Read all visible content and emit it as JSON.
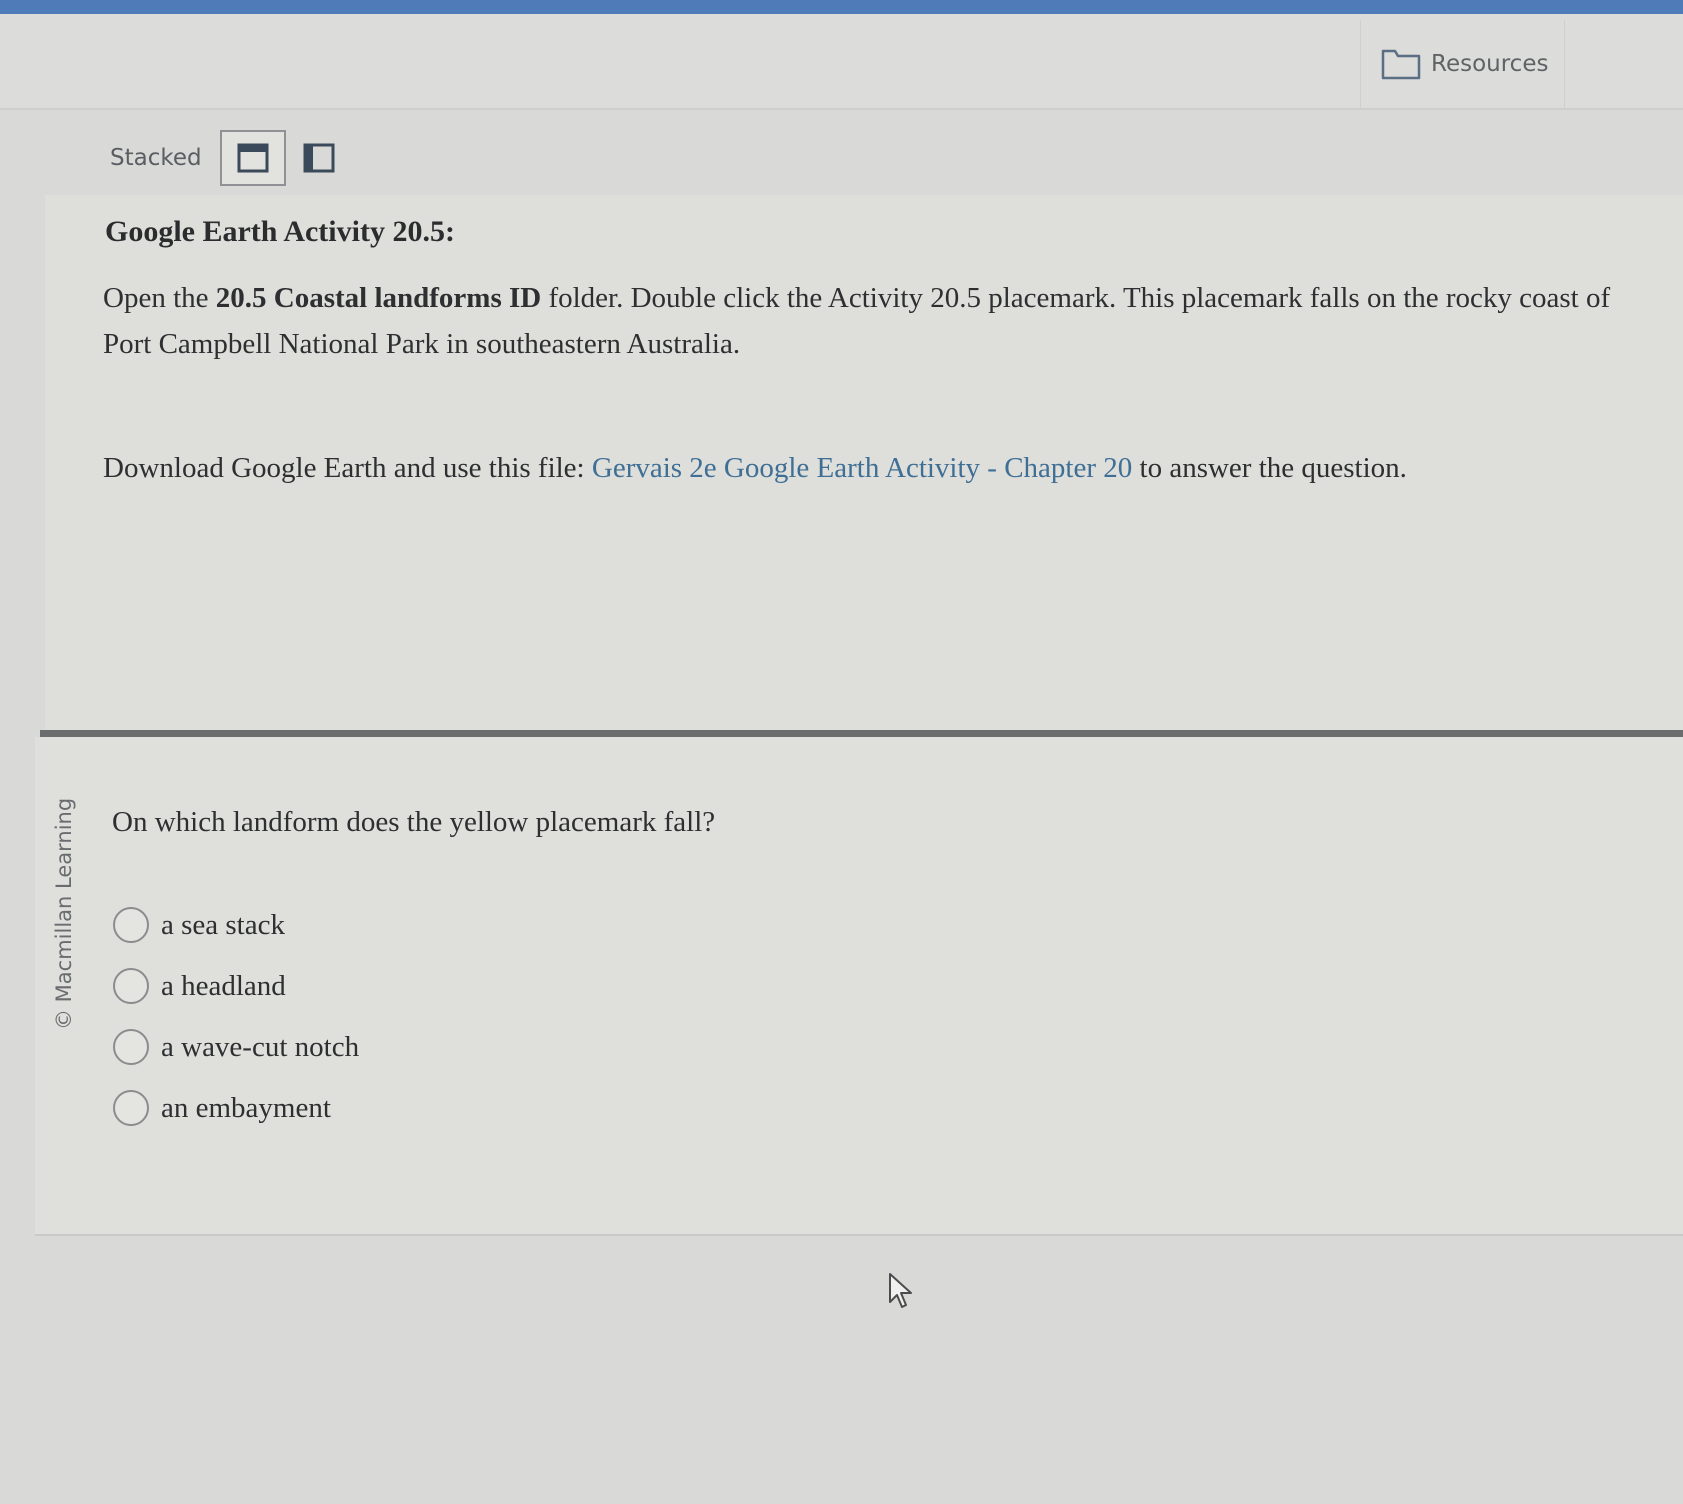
{
  "header": {
    "resources_label": "Resources",
    "resources_icon": "folder-icon"
  },
  "layout_toggle": {
    "label": "Stacked",
    "options": [
      {
        "icon": "stacked-layout-icon",
        "active": true
      },
      {
        "icon": "side-by-side-layout-icon",
        "active": false
      }
    ]
  },
  "content": {
    "title": "Google Earth Activity 20.5:",
    "instructions": {
      "part1": "Open the ",
      "folder_name": "20.5 Coastal landforms ID",
      "part2": " folder. Double click the Activity 20.5 placemark. This placemark falls on the rocky coast of Port Campbell National Park in southeastern Australia."
    },
    "download": {
      "before": "Download Google Earth and use this file: ",
      "link_text": "Gervais 2e Google Earth Activity - Chapter 20",
      "after": " to answer the question."
    }
  },
  "watermark": "© Macmillan Learning",
  "question": {
    "text": "On which landform does the yellow placemark fall?",
    "options": [
      "a sea stack",
      "a headland",
      "a wave-cut notch",
      "an embayment"
    ]
  },
  "colors": {
    "top_bar": "#4f7bb8",
    "link": "#3f6f95",
    "divider": "#6b6c6d"
  }
}
